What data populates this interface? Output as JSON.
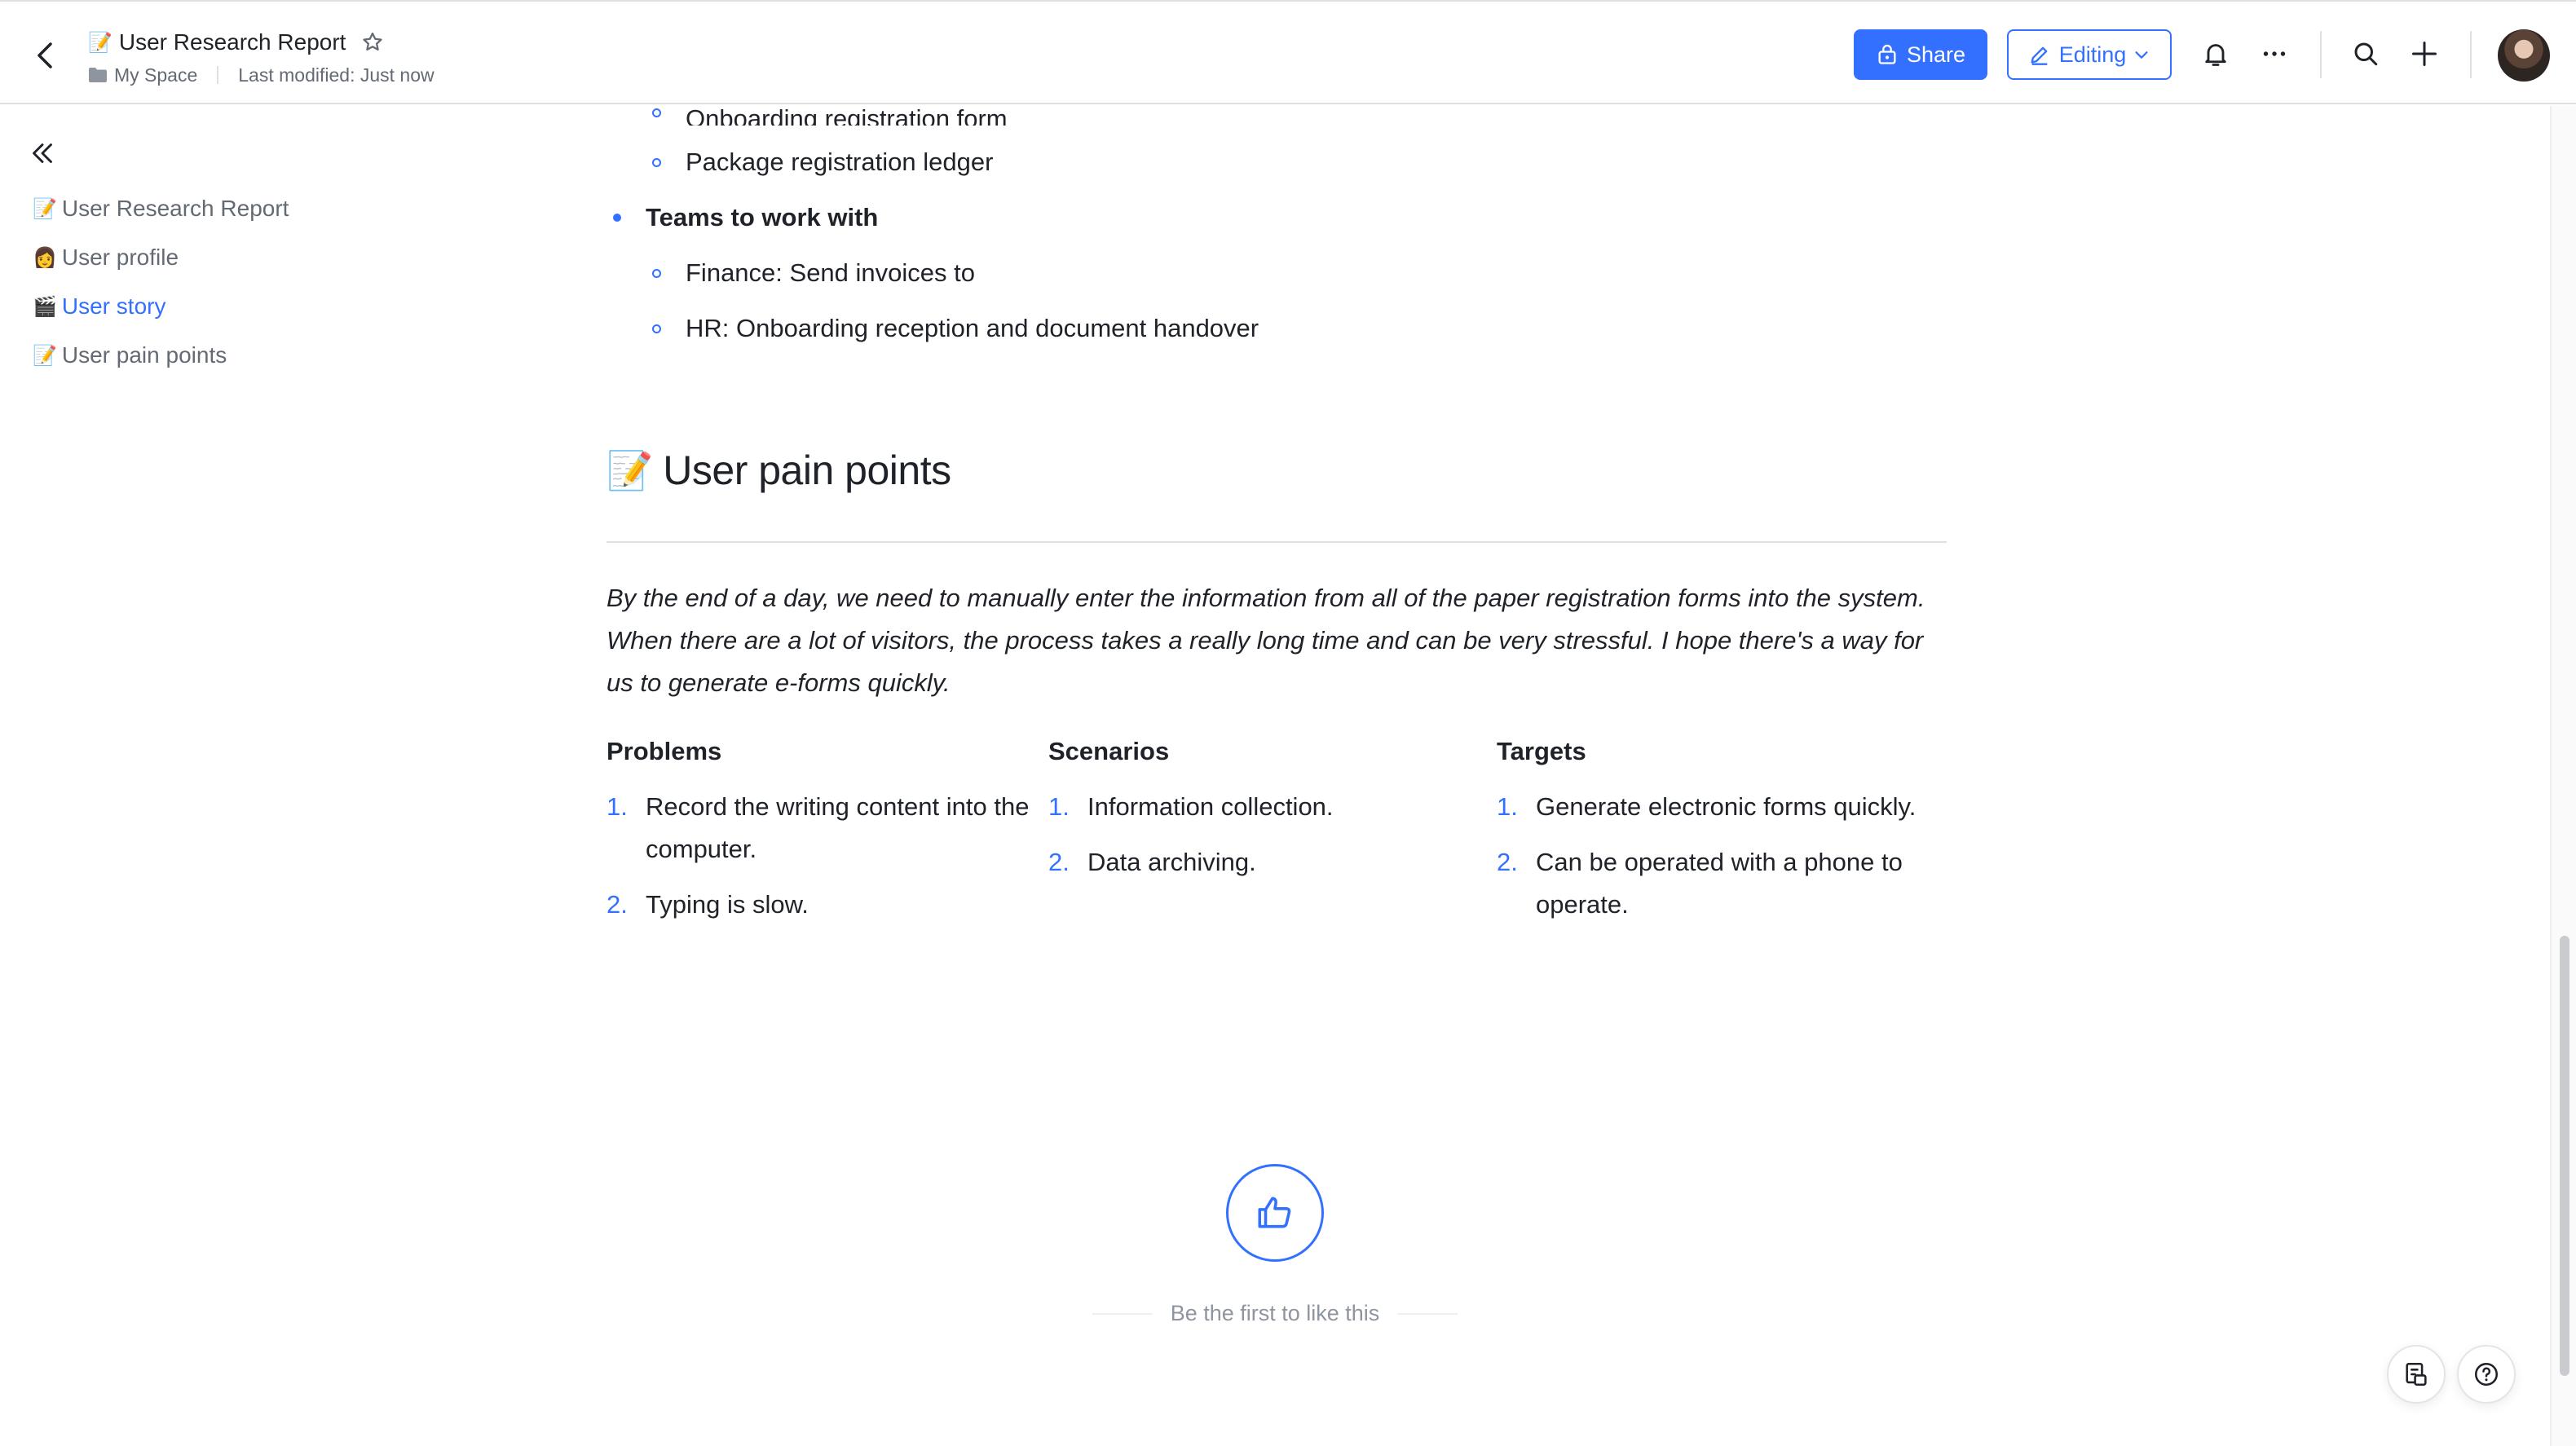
{
  "header": {
    "title_emoji": "📝",
    "title": "User Research Report",
    "breadcrumb_space": "My Space",
    "last_modified": "Last modified: Just now",
    "share_label": "Share",
    "editing_label": "Editing"
  },
  "outline": {
    "items": [
      {
        "emoji": "📝",
        "label": "User Research Report"
      },
      {
        "emoji": "👩",
        "label": "User profile"
      },
      {
        "emoji": "🎬",
        "label": "User story"
      },
      {
        "emoji": "📝",
        "label": "User pain points"
      }
    ]
  },
  "content": {
    "clipped_item": "Onboarding registration form",
    "sub_item_ledger": "Package registration ledger",
    "teams_heading": "Teams to work with",
    "team_items": [
      "Finance: Send invoices to",
      "HR: Onboarding reception and document handover"
    ],
    "section_emoji": "📝",
    "section_title": "User pain points",
    "quote": "By the end of a day, we need to manually enter the information from all of the paper registration forms into the system. When there are a lot of visitors, the process takes a really long time and can be very stressful. I hope there's a way for us to generate e-forms quickly.",
    "columns": [
      {
        "heading": "Problems",
        "items": [
          {
            "num": "1.",
            "text": "Record the writing content into the computer."
          },
          {
            "num": "2.",
            "text": "Typing is slow."
          }
        ]
      },
      {
        "heading": "Scenarios",
        "items": [
          {
            "num": "1.",
            "text": "Information collection."
          },
          {
            "num": "2.",
            "text": "Data archiving."
          }
        ]
      },
      {
        "heading": "Targets",
        "items": [
          {
            "num": "1.",
            "text": "Generate electronic forms quickly."
          },
          {
            "num": "2.",
            "text": "Can be operated with a phone to operate."
          }
        ]
      }
    ],
    "like_caption": "Be the first to like this"
  },
  "colors": {
    "accent": "#3370ff",
    "text": "#1f2329",
    "muted": "#646a73",
    "border": "#dee0e3"
  }
}
